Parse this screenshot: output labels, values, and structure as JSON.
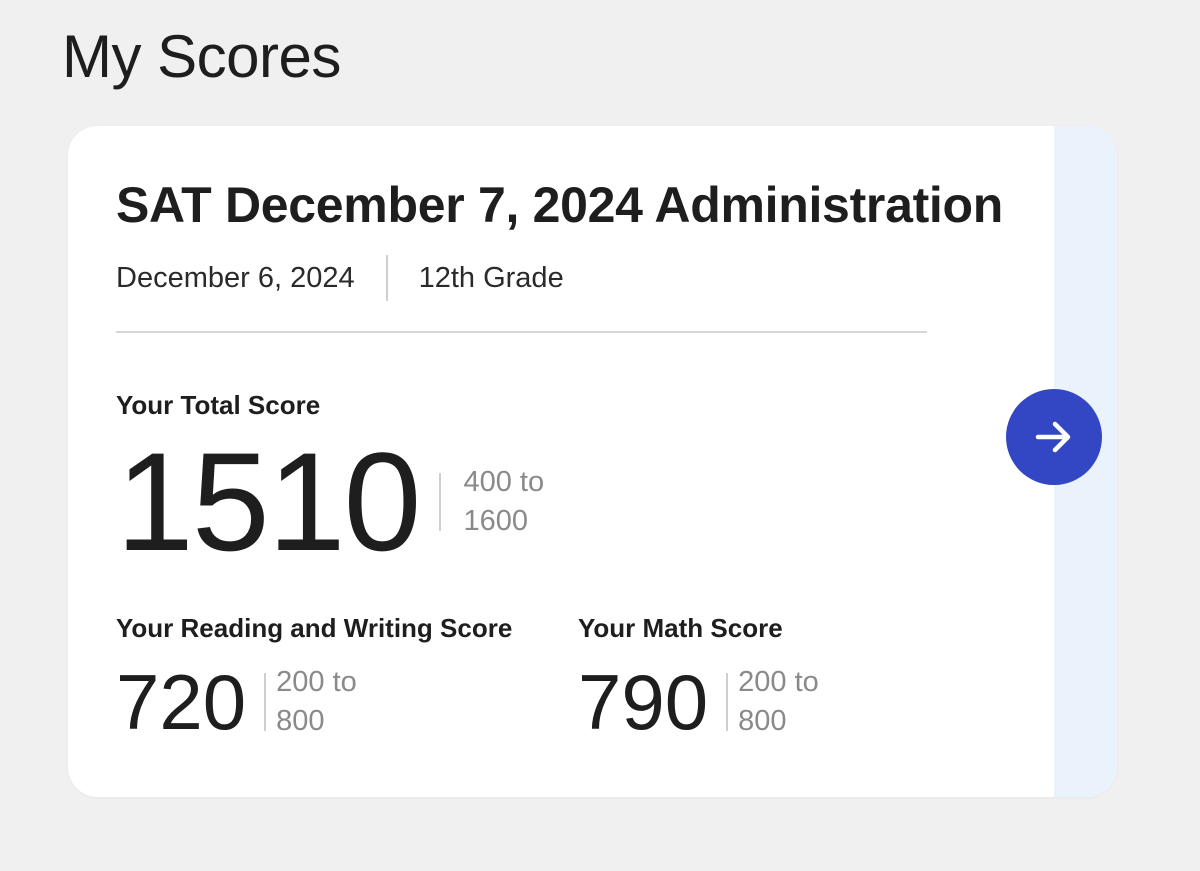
{
  "page": {
    "title": "My Scores"
  },
  "score_card": {
    "title": "SAT December 7, 2024 Administration",
    "date": "December 6, 2024",
    "grade": "12th Grade",
    "total": {
      "label": "Your Total Score",
      "value": "1510",
      "range_line1": "400 to",
      "range_line2": "1600"
    },
    "reading_writing": {
      "label": "Your Reading and Writing Score",
      "value": "720",
      "range_line1": "200 to",
      "range_line2": "800"
    },
    "math": {
      "label": "Your Math Score",
      "value": "790",
      "range_line1": "200 to",
      "range_line2": "800"
    },
    "next_button_icon": "arrow-right-icon"
  },
  "colors": {
    "background": "#f0f0f0",
    "card": "#ffffff",
    "side_strip": "#eaf3fc",
    "accent": "#3346c4",
    "text": "#1e1e1e",
    "muted_text": "#8a8a8a"
  }
}
